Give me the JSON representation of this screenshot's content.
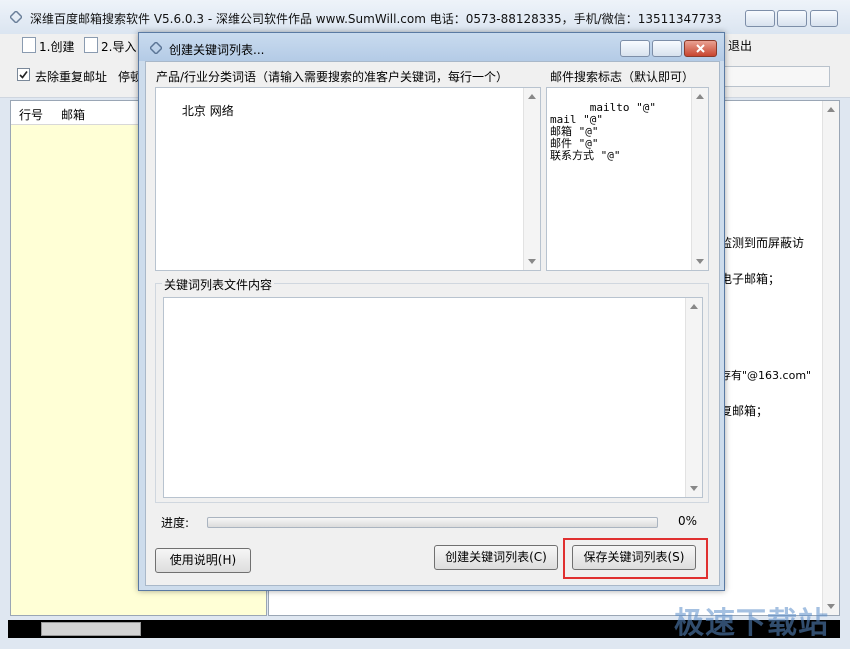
{
  "main": {
    "title": "深维百度邮箱搜索软件 V5.6.0.3 - 深维公司软件作品 www.SumWill.com  电话：0573-88128335，手机/微信：13511347733",
    "toolbar": {
      "create": "1.创建",
      "import": "2.导入",
      "exit": "退出"
    },
    "options": {
      "dedupe_label": "去除重复邮址",
      "dedupe_checked": true,
      "stop_label": "停顿"
    },
    "list_headers": {
      "row": "行号",
      "email": "邮箱"
    },
    "right_text": [
      "监测到而屏蔽访",
      "电子邮箱；",
      "存有\"@163.com\"",
      "复邮箱；"
    ]
  },
  "dialog": {
    "title": "创建关键词列表...",
    "keywords_label": "产品/行业分类词语（请输入需要搜索的准客户关键词，每行一个）",
    "keywords_value": "北京 网络",
    "markers_label": "邮件搜索标志（默认即可）",
    "markers_value": "mailto \"@\"\nmail \"@\"\n邮箱 \"@\"\n邮件 \"@\"\n联系方式 \"@\"",
    "file_group_label": "关键词列表文件内容",
    "file_content": "",
    "progress_label": "进度:",
    "progress_value": "0%",
    "progress_fraction": 0,
    "help_button": "使用说明(H)",
    "create_button": "创建关键词列表(C)",
    "save_button": "保存关键词列表(S)"
  },
  "watermark": "极速下载站"
}
